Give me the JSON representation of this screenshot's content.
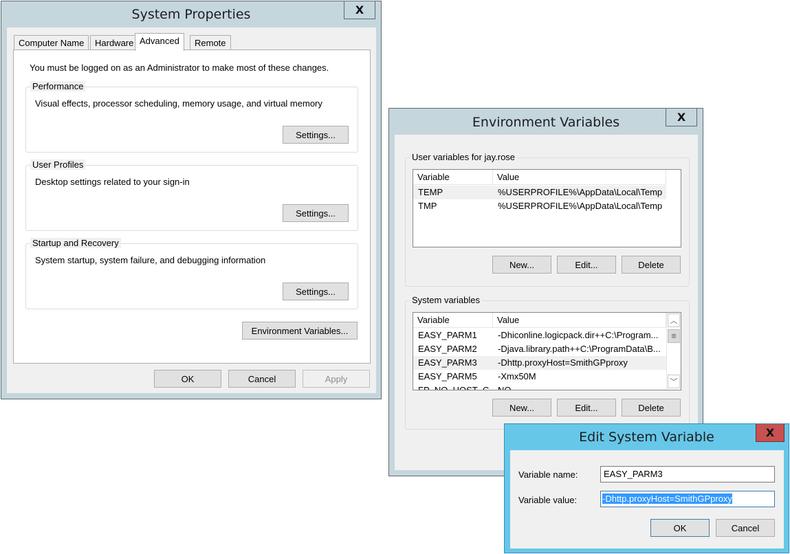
{
  "system_properties": {
    "title": "System Properties",
    "close_glyph": "X",
    "tabs": [
      {
        "label": "Computer Name",
        "selected": false
      },
      {
        "label": "Hardware",
        "selected": false
      },
      {
        "label": "Advanced",
        "selected": true
      },
      {
        "label": "Remote",
        "selected": false
      }
    ],
    "admin_notice": "You must be logged on as an Administrator to make most of these changes.",
    "groups": [
      {
        "title": "Performance",
        "description": "Visual effects, processor scheduling, memory usage, and virtual memory",
        "button": "Settings..."
      },
      {
        "title": "User Profiles",
        "description": "Desktop settings related to your sign-in",
        "button": "Settings..."
      },
      {
        "title": "Startup and Recovery",
        "description": "System startup, system failure, and debugging information",
        "button": "Settings..."
      }
    ],
    "env_button": "Environment Variables...",
    "ok": "OK",
    "cancel": "Cancel",
    "apply": "Apply"
  },
  "environment_variables": {
    "title": "Environment Variables",
    "close_glyph": "X",
    "user_group_title": "User variables for jay.rose",
    "columns": [
      "Variable",
      "Value"
    ],
    "user_rows": [
      {
        "variable": "TEMP",
        "value": "%USERPROFILE%\\AppData\\Local\\Temp",
        "highlighted": true
      },
      {
        "variable": "TMP",
        "value": "%USERPROFILE%\\AppData\\Local\\Temp",
        "highlighted": false
      }
    ],
    "system_group_title": "System variables",
    "system_rows": [
      {
        "variable": "EASY_PARM1",
        "value": "-Dhiconline.logicpack.dir++C:\\Program...",
        "highlighted": false
      },
      {
        "variable": "EASY_PARM2",
        "value": "-Djava.library.path++C:\\ProgramData\\B...",
        "highlighted": false
      },
      {
        "variable": "EASY_PARM3",
        "value": "-Dhttp.proxyHost=SmithGPproxy",
        "highlighted": true
      },
      {
        "variable": "EASY_PARM5",
        "value": "-Xmx50M",
        "highlighted": false
      },
      {
        "variable": "FP_NO_HOST_C...",
        "value": "NO",
        "highlighted": false
      }
    ],
    "new": "New...",
    "edit": "Edit...",
    "delete": "Delete",
    "scroll_up_glyph": "︿",
    "scroll_down_glyph": "﹀",
    "scroll_thumb_glyph": "≡"
  },
  "edit_system_variable": {
    "title": "Edit System Variable",
    "close_glyph": "X",
    "name_label": "Variable name:",
    "name_value": "EASY_PARM3",
    "value_label": "Variable value:",
    "value_value": "-Dhttp.proxyHost=SmithGPproxy",
    "ok": "OK",
    "cancel": "Cancel"
  }
}
